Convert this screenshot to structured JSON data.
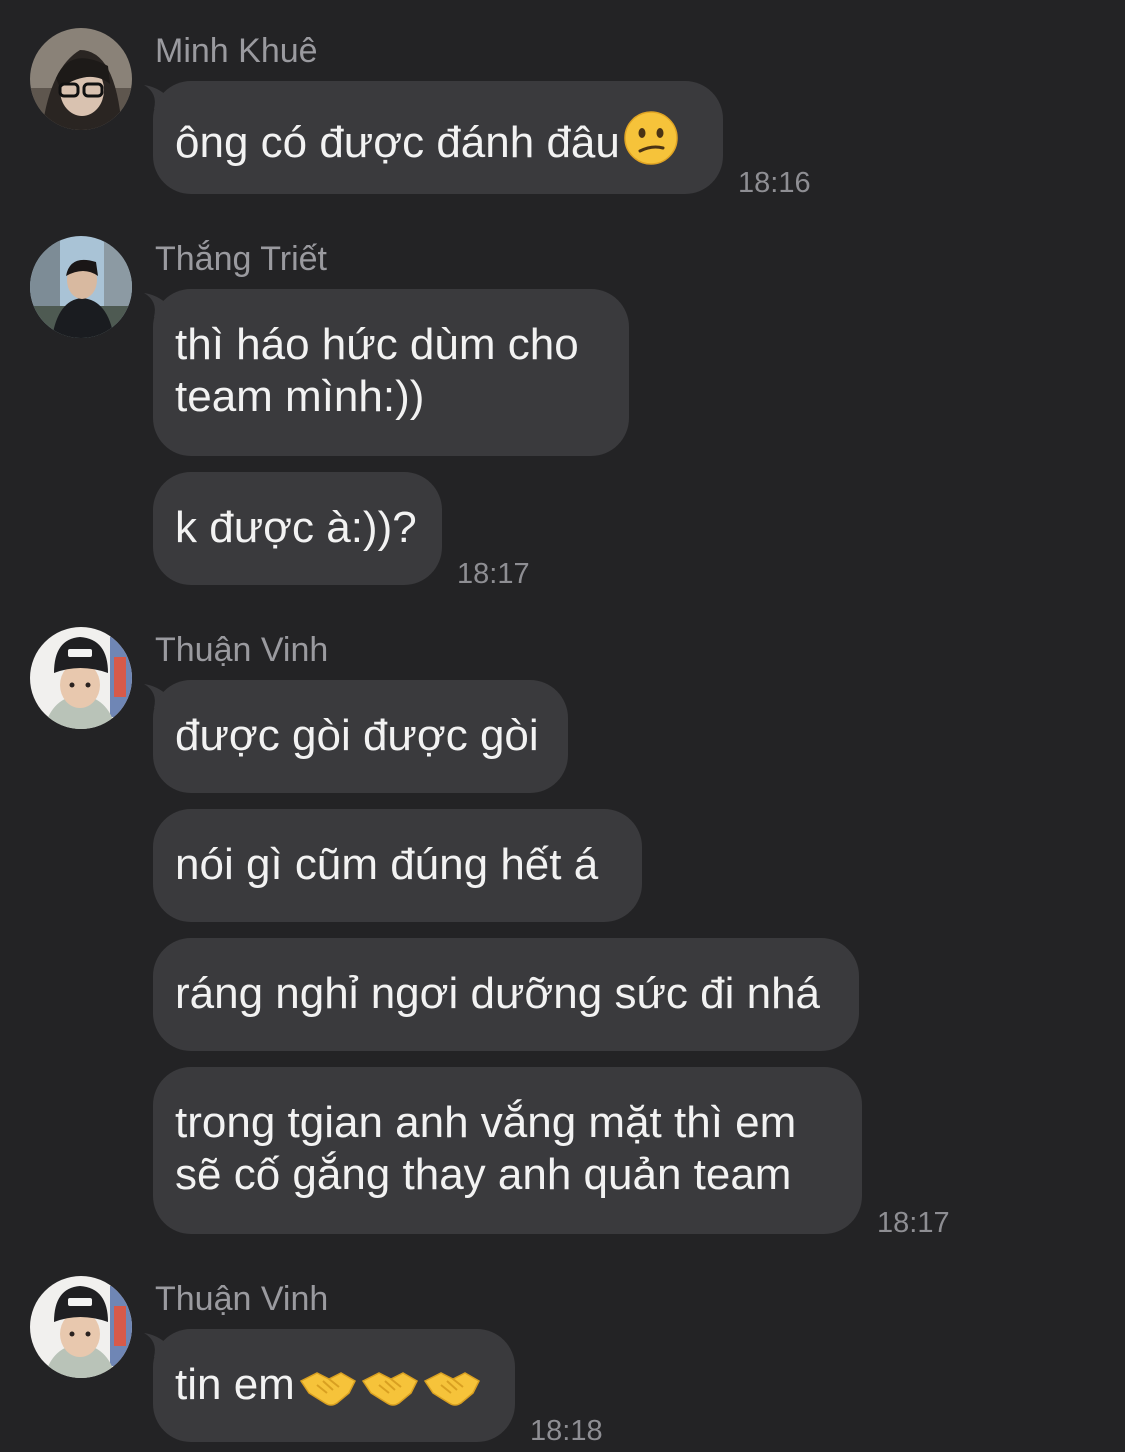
{
  "groups": [
    {
      "sender": "Minh Khuê",
      "avatar": "avatar-minh-khue",
      "messages": [
        {
          "text": "ông có được đánh đâu",
          "emoji": "confused-face"
        }
      ],
      "time": "18:16"
    },
    {
      "sender": "Thắng Triết",
      "avatar": "avatar-thang-triet",
      "messages": [
        {
          "lines": [
            "thì háo hức dùm cho",
            "team mình:))"
          ]
        },
        {
          "text": "k được à:))?"
        }
      ],
      "time": "18:17"
    },
    {
      "sender": "Thuận Vinh",
      "avatar": "avatar-thuan-vinh",
      "messages": [
        {
          "text": "được gòi được gòi"
        },
        {
          "text": "nói gì cũm đúng hết á"
        },
        {
          "text": "ráng nghỉ ngơi dưỡng sức đi nhá"
        },
        {
          "lines": [
            "trong tgian anh vắng mặt thì em",
            "sẽ cố gắng thay anh quản team"
          ]
        }
      ],
      "time": "18:17"
    },
    {
      "sender": "Thuận Vinh",
      "avatar": "avatar-thuan-vinh",
      "messages": [
        {
          "text": "tin em",
          "emoji": "handshake x3"
        }
      ],
      "time": "18:18"
    }
  ],
  "colors": {
    "background": "#232325",
    "bubble": "#3a3a3d",
    "message_text": "#f2f2f2",
    "sender_name": "#9a9a9f",
    "timestamp": "#8e8e93"
  }
}
